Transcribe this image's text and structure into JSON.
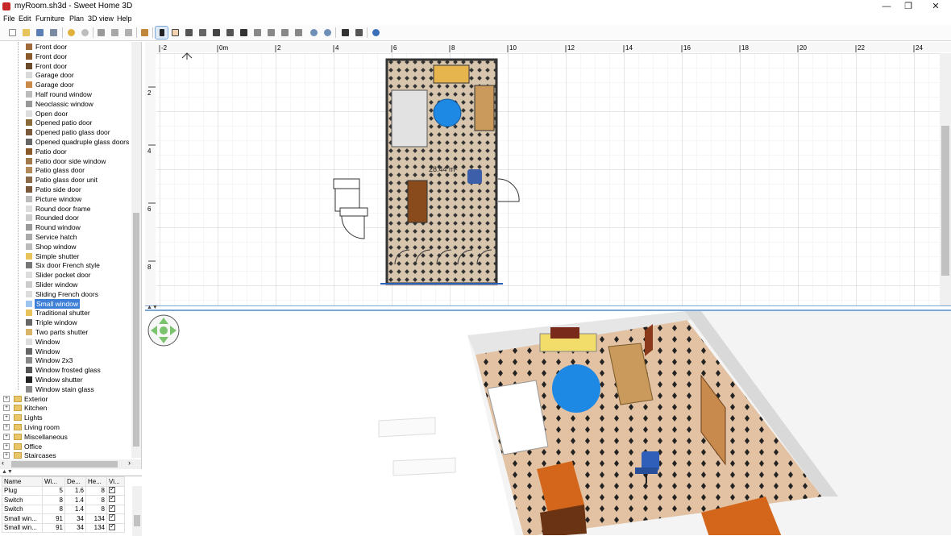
{
  "window": {
    "title": "myRoom.sh3d - Sweet Home 3D",
    "minimize": "—",
    "maximize": "❐",
    "close": "✕"
  },
  "menu": [
    "File",
    "Edit",
    "Furniture",
    "Plan",
    "3D view",
    "Help"
  ],
  "toolbar_icons": [
    "new-file-icon",
    "open-icon",
    "save-icon",
    "cut-tool-icon",
    "undo-icon",
    "redo-icon",
    "cut-icon",
    "copy-icon",
    "paste-icon",
    "add-furniture-icon",
    "select-mode-icon",
    "pan-mode-icon",
    "create-walls-icon",
    "create-rooms-icon",
    "create-polylines-icon",
    "create-dimensions-icon",
    "create-labels-icon",
    "text-style-icon",
    "increase-text-icon",
    "decrease-text-icon",
    "zoom-in-icon",
    "zoom-out-icon",
    "create-photo-icon",
    "create-video-icon",
    "help-icon"
  ],
  "catalog": {
    "items": [
      "Front door",
      "Front door",
      "Front door",
      "Garage door",
      "Garage door",
      "Half round window",
      "Neoclassic window",
      "Open door",
      "Opened patio door",
      "Opened patio glass door",
      "Opened quadruple glass doors",
      "Patio door",
      "Patio door side window",
      "Patio glass door",
      "Patio glass door unit",
      "Patio side door",
      "Picture window",
      "Round door frame",
      "Rounded door",
      "Round window",
      "Service hatch",
      "Shop window",
      "Simple shutter",
      "Six door French style",
      "Slider pocket door",
      "Slider window",
      "Sliding French doors",
      "Small window",
      "Traditional shutter",
      "Triple window",
      "Two parts shutter",
      "Window",
      "Window",
      "Window 2x3",
      "Window frosted glass",
      "Window shutter",
      "Window stain glass"
    ],
    "selected_item": "Small window",
    "categories": [
      "Exterior",
      "Kitchen",
      "Lights",
      "Living room",
      "Miscellaneous",
      "Office",
      "Staircases"
    ]
  },
  "furniture_table": {
    "headers": [
      "Name",
      "Wi...",
      "De...",
      "He...",
      "Vi..."
    ],
    "rows": [
      {
        "name": "Plug",
        "w": "5",
        "d": "1.6",
        "h": "8"
      },
      {
        "name": "Switch",
        "w": "8",
        "d": "1.4",
        "h": "8"
      },
      {
        "name": "Switch",
        "w": "8",
        "d": "1.4",
        "h": "8"
      },
      {
        "name": "Small win...",
        "w": "91",
        "d": "34",
        "h": "134"
      },
      {
        "name": "Small win...",
        "w": "91",
        "d": "34",
        "h": "134"
      }
    ]
  },
  "plan": {
    "ruler_x": [
      "-2",
      "0m",
      "2",
      "4",
      "6",
      "8",
      "10",
      "12",
      "14",
      "16",
      "18",
      "20",
      "22",
      "24"
    ],
    "ruler_y": [
      "2",
      "4",
      "6",
      "8"
    ],
    "room_area": "28.44 m²"
  }
}
